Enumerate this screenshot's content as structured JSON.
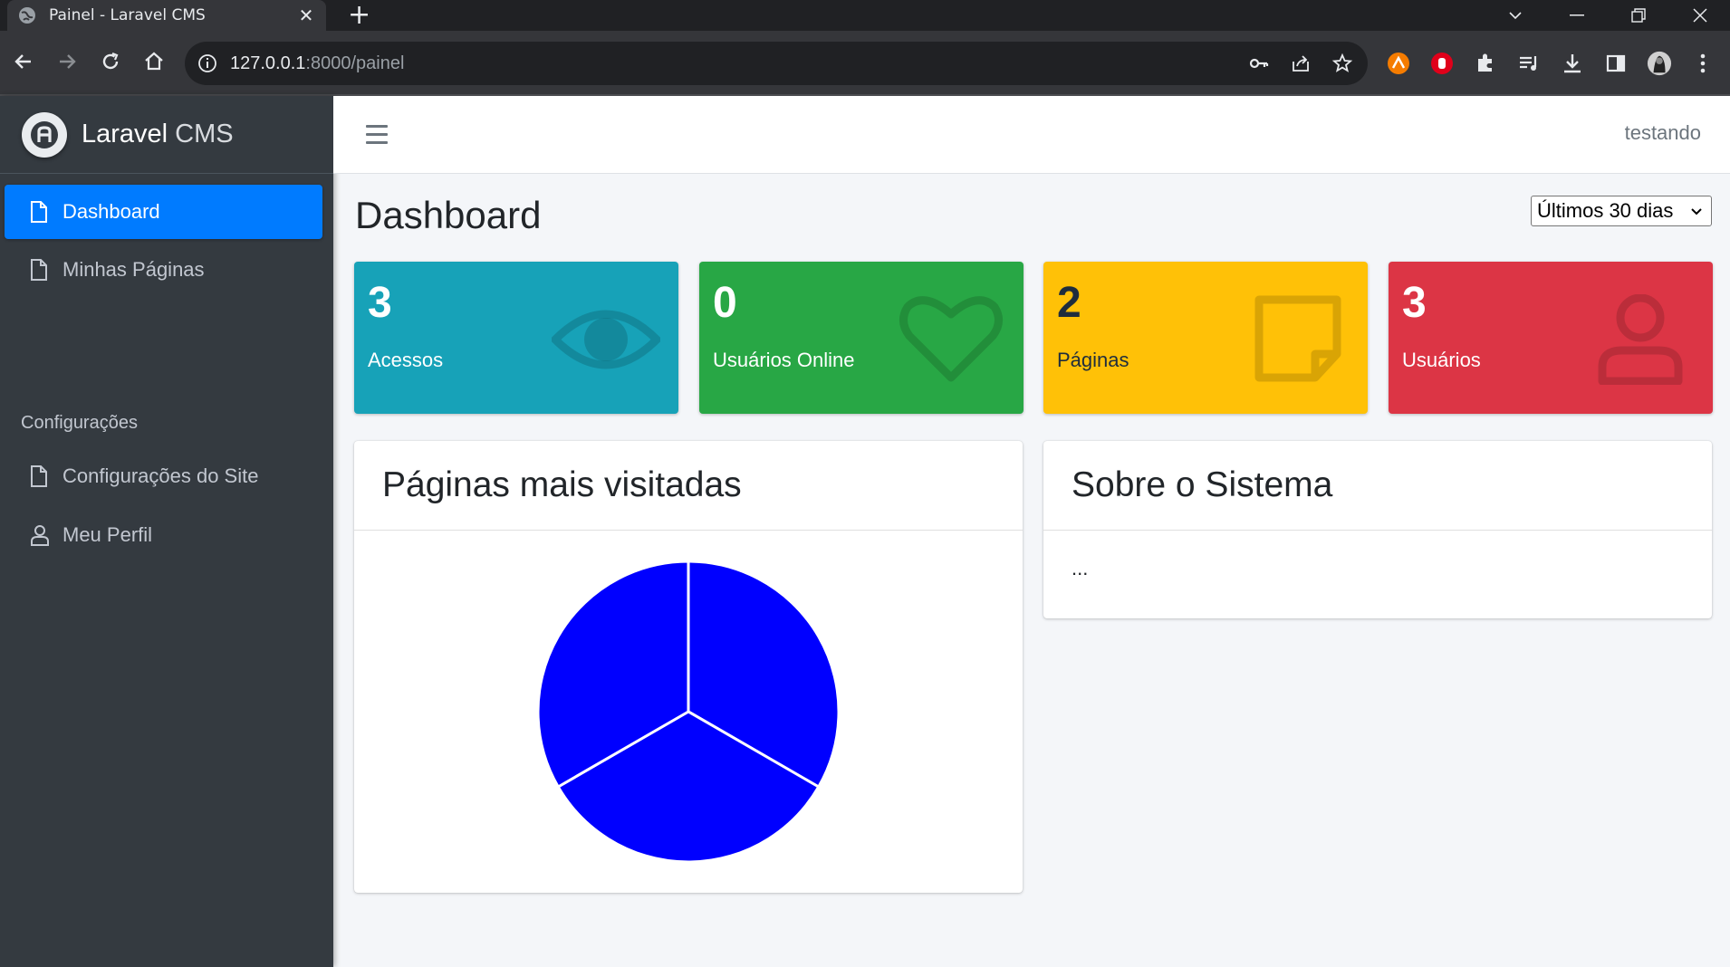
{
  "browser": {
    "tab_title": "Painel - Laravel CMS",
    "url_host": "127.0.0.1",
    "url_rest": ":8000/painel"
  },
  "brand": {
    "name_bold": "Laravel",
    "name_light": " CMS"
  },
  "sidebar": {
    "items": [
      {
        "label": "Dashboard",
        "icon": "file-icon",
        "active": true
      },
      {
        "label": "Minhas Páginas",
        "icon": "file-icon"
      },
      {
        "header": "Configurações"
      },
      {
        "label": "Configurações do Site",
        "icon": "file-icon"
      },
      {
        "label": "Meu Perfil",
        "icon": "user-icon"
      }
    ]
  },
  "topnav": {
    "user": "testando"
  },
  "main": {
    "title": "Dashboard",
    "range": {
      "selected": "Últimos 30 dias"
    },
    "stats": [
      {
        "count": "3",
        "label": "Acessos",
        "icon": "eye-icon",
        "color": "#17a2b8"
      },
      {
        "count": "0",
        "label": "Usuários Online",
        "icon": "heart-icon",
        "color": "#28a745"
      },
      {
        "count": "2",
        "label": "Páginas",
        "icon": "sticky-note-icon",
        "color": "#ffc107"
      },
      {
        "count": "3",
        "label": "Usuários",
        "icon": "user-icon",
        "color": "#dc3545"
      }
    ],
    "visited_card": {
      "title": "Páginas mais visitadas"
    },
    "about_card": {
      "title": "Sobre o Sistema",
      "body": "..."
    }
  },
  "chart_data": {
    "type": "pie",
    "values": [
      1,
      1,
      1
    ],
    "colors": [
      "#0000ff",
      "#0000ff",
      "#0000ff"
    ]
  }
}
